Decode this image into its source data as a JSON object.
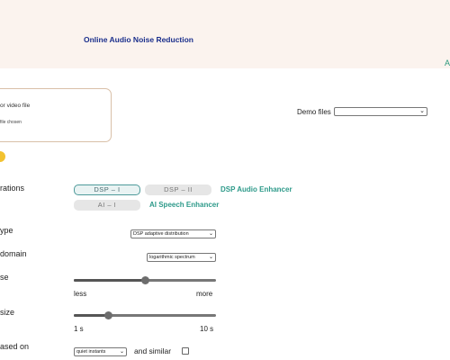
{
  "header": {
    "title": "Online Audio Noise Reduction",
    "corner_letter": "A"
  },
  "upload": {
    "title": "or video file",
    "status": "file chosen"
  },
  "demo": {
    "label": "Demo files",
    "selected": ""
  },
  "left_labels": [
    "rations",
    "ype",
    "domain",
    "se",
    "size",
    "ased on"
  ],
  "modes": [
    {
      "label": "DSP – I",
      "active": true
    },
    {
      "label": "DSP – II",
      "active": false
    },
    {
      "label": "AI – I",
      "active": false
    }
  ],
  "links": {
    "dsp": "DSP Audio Enhancer",
    "ai": "AI Speech Enhancer"
  },
  "selects": {
    "type": "DSP adaptive distribution",
    "domain": "logarithmic spectrum",
    "based_on": "quiet instants"
  },
  "sliders": {
    "noise": {
      "min_label": "less",
      "max_label": "more",
      "level": 0.5
    },
    "size": {
      "min_label": "1 s",
      "max_label": "10 s",
      "level": 0.25
    }
  },
  "similar_label": "and similar",
  "colors": {
    "header_bg": "#fbf3ee",
    "title": "#1b2f8c",
    "accent_green": "#2e9a8a",
    "dot": "#f2c230"
  }
}
